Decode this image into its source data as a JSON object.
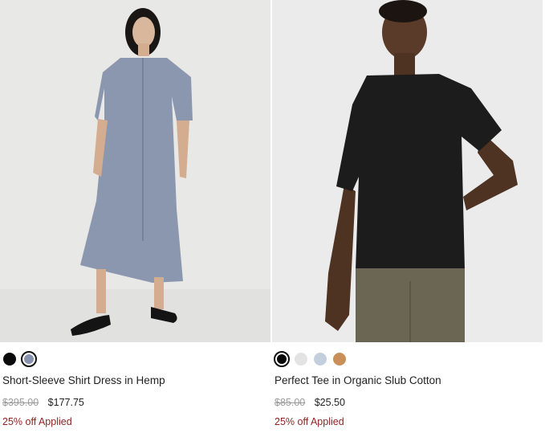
{
  "products": [
    {
      "name": "Short-Sleeve Shirt Dress in Hemp",
      "original_price": "$395.00",
      "sale_price": "$177.75",
      "promo": "25% off Applied",
      "image_icon": "model-wearing-dress-photo",
      "swatches": [
        {
          "color": "#0a0a0a",
          "selected": false
        },
        {
          "color": "#8a93ad",
          "selected": true
        }
      ]
    },
    {
      "name": "Perfect Tee in Organic Slub Cotton",
      "original_price": "$85.00",
      "sale_price": "$25.50",
      "promo": "25% off Applied",
      "image_icon": "model-wearing-tee-photo",
      "swatches": [
        {
          "color": "#0a0a0a",
          "selected": true
        },
        {
          "color": "#e3e3e3",
          "selected": false
        },
        {
          "color": "#c3cfdc",
          "selected": false
        },
        {
          "color": "#c98f58",
          "selected": false
        }
      ]
    }
  ],
  "colors": {
    "promo": "#8e2424",
    "photo_bg": "#e9e9e9",
    "dress": "#8a96ad",
    "tee": "#1b1b1b",
    "trousers": "#6b6553"
  }
}
